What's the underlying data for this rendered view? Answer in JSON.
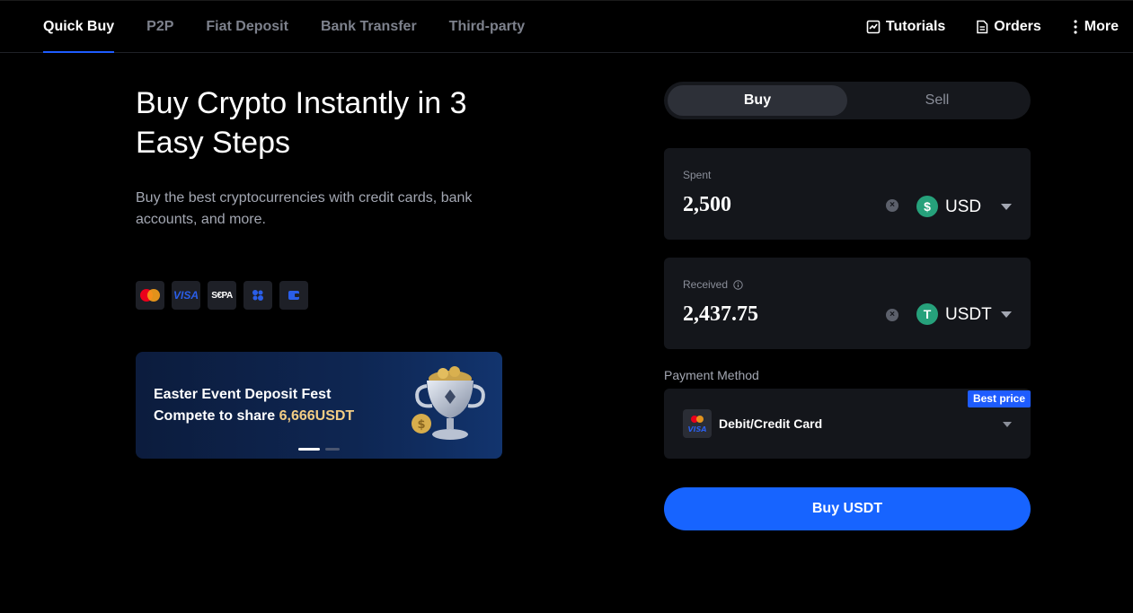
{
  "nav": {
    "tabs": [
      {
        "label": "Quick Buy",
        "active": true
      },
      {
        "label": "P2P"
      },
      {
        "label": "Fiat Deposit"
      },
      {
        "label": "Bank Transfer"
      },
      {
        "label": "Third-party"
      }
    ],
    "right": {
      "tutorials": "Tutorials",
      "orders": "Orders",
      "more": "More"
    }
  },
  "hero": {
    "title": "Buy Crypto Instantly in 3 Easy Steps",
    "subtitle": "Buy the best cryptocurrencies with credit cards, bank accounts, and more.",
    "payment_icons": [
      "mastercard-icon",
      "visa-icon",
      "sepa-icon",
      "apple-pay-icon",
      "wallet-icon"
    ],
    "visa_text": "VISA",
    "sepa_text": "S€PA"
  },
  "banner": {
    "line1": "Easter Event Deposit Fest",
    "line2_prefix": "Compete to share ",
    "line2_highlight": "6,666USDT",
    "slide_active": 1,
    "slide_count": 2
  },
  "trade": {
    "buy_label": "Buy",
    "sell_label": "Sell",
    "spent": {
      "label": "Spent",
      "value": "2,500",
      "currency": "USD",
      "coin_symbol": "$"
    },
    "received": {
      "label": "Received",
      "value": "2,437.75",
      "currency": "USDT",
      "coin_symbol": "T"
    },
    "payment_method": {
      "label": "Payment Method",
      "badge": "Best price",
      "value": "Debit/Credit Card"
    },
    "cta": "Buy USDT"
  },
  "colors": {
    "accent": "#1764ff",
    "tether": "#26a17b",
    "highlight": "#f3cd84",
    "background": "#000000",
    "panel": "#14161b"
  }
}
